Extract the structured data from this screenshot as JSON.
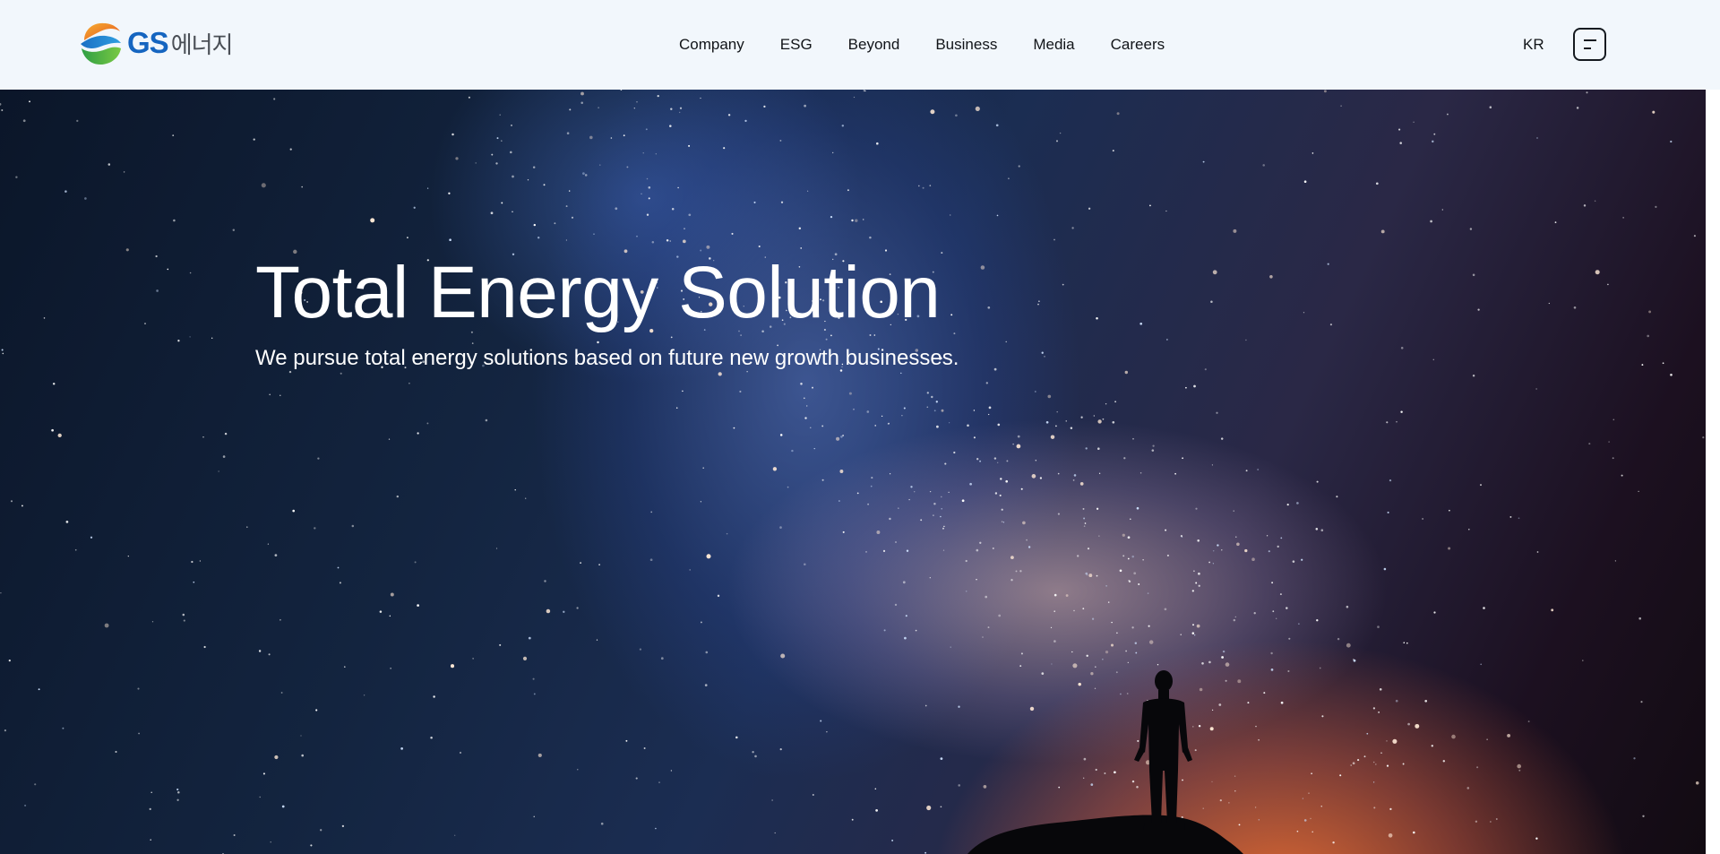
{
  "brand": {
    "logo_latin": "GS",
    "logo_korean": "에너지",
    "colors": {
      "primary": "#1565c0",
      "logo_orange": "#f28c28",
      "logo_green": "#3cb44b"
    }
  },
  "nav": {
    "items": [
      "Company",
      "ESG",
      "Beyond",
      "Business",
      "Media",
      "Careers"
    ]
  },
  "header": {
    "language": "KR",
    "menu_icon": "menu-icon"
  },
  "hero": {
    "title": "Total Energy Solution",
    "subtitle": "We pursue total energy solutions based on future new growth businesses."
  }
}
